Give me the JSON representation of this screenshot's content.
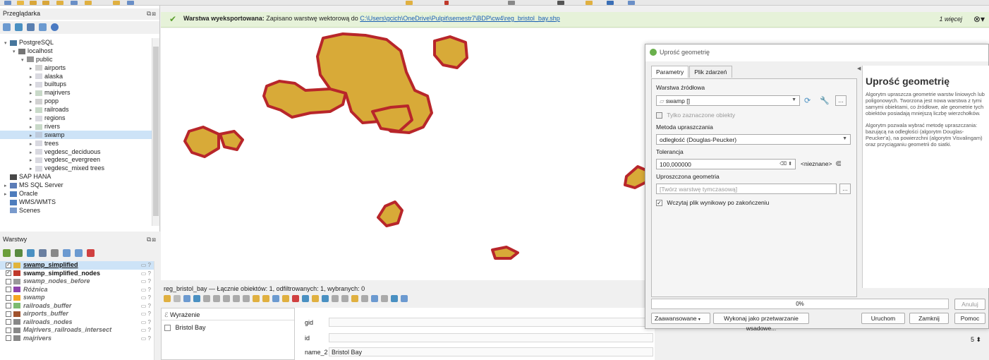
{
  "browser_panel": {
    "title": "Przeglądarka",
    "tree": [
      {
        "label": "PostgreSQL",
        "level": 0,
        "arrow": "▾",
        "icon": "postgres-icon"
      },
      {
        "label": "localhost",
        "level": 1,
        "arrow": "▾",
        "icon": "server-icon"
      },
      {
        "label": "public",
        "level": 2,
        "arrow": "▾",
        "icon": "schema-icon"
      },
      {
        "label": "airports",
        "level": 3,
        "arrow": "▸",
        "icon": "point-layer-icon"
      },
      {
        "label": "alaska",
        "level": 3,
        "arrow": "▸",
        "icon": "polygon-layer-icon"
      },
      {
        "label": "builtups",
        "level": 3,
        "arrow": "▸",
        "icon": "polygon-layer-icon"
      },
      {
        "label": "majrivers",
        "level": 3,
        "arrow": "▸",
        "icon": "line-layer-icon"
      },
      {
        "label": "popp",
        "level": 3,
        "arrow": "▸",
        "icon": "point-layer-icon"
      },
      {
        "label": "railroads",
        "level": 3,
        "arrow": "▸",
        "icon": "line-layer-icon"
      },
      {
        "label": "regions",
        "level": 3,
        "arrow": "▸",
        "icon": "polygon-layer-icon"
      },
      {
        "label": "rivers",
        "level": 3,
        "arrow": "▸",
        "icon": "line-layer-icon"
      },
      {
        "label": "swamp",
        "level": 3,
        "arrow": "▸",
        "icon": "polygon-layer-icon",
        "selected": true
      },
      {
        "label": "trees",
        "level": 3,
        "arrow": "▸",
        "icon": "polygon-layer-icon"
      },
      {
        "label": "vegdesc_deciduous",
        "level": 3,
        "arrow": "▸",
        "icon": "polygon-layer-icon"
      },
      {
        "label": "vegdesc_evergreen",
        "level": 3,
        "arrow": "▸",
        "icon": "polygon-layer-icon"
      },
      {
        "label": "vegdesc_mixed trees",
        "level": 3,
        "arrow": "▸",
        "icon": "polygon-layer-icon"
      },
      {
        "label": "SAP HANA",
        "level": 0,
        "arrow": "",
        "icon": "sap-icon"
      },
      {
        "label": "MS SQL Server",
        "level": 0,
        "arrow": "▸",
        "icon": "mssql-icon"
      },
      {
        "label": "Oracle",
        "level": 0,
        "arrow": "▸",
        "icon": "oracle-icon"
      },
      {
        "label": "WMS/WMTS",
        "level": 0,
        "arrow": "",
        "icon": "wms-icon"
      },
      {
        "label": "Scenes",
        "level": 0,
        "arrow": "",
        "icon": "scenes-icon"
      }
    ]
  },
  "layers_panel": {
    "title": "Warstwy",
    "layers": [
      {
        "label": "swamp_simplified",
        "checked": true,
        "swatch": "#e1b43c",
        "style": "bold",
        "selected": true
      },
      {
        "label": "swamp_simplified_nodes",
        "checked": true,
        "swatch": "#c0392b",
        "style": "act"
      },
      {
        "label": "swamp_nodes_before",
        "checked": false,
        "swatch": "#999999",
        "style": "off"
      },
      {
        "label": "Różnica",
        "checked": false,
        "swatch": "#8e44ad",
        "style": "off"
      },
      {
        "label": "swamp",
        "checked": false,
        "swatch": "#f5a623",
        "style": "off"
      },
      {
        "label": "railroads_buffer",
        "checked": false,
        "swatch": "#7dbb6f",
        "style": "off"
      },
      {
        "label": "airports_buffer",
        "checked": false,
        "swatch": "#a0522d",
        "style": "off"
      },
      {
        "label": "railroads_nodes",
        "checked": false,
        "swatch": "#888888",
        "style": "off"
      },
      {
        "label": "Majrivers_railroads_intersect",
        "checked": false,
        "swatch": "#888888",
        "style": "off"
      },
      {
        "label": "majrivers",
        "checked": false,
        "swatch": "#888888",
        "style": "off"
      }
    ]
  },
  "message_bar": {
    "bold": "Warstwa wyeksportowana:",
    "text": " Zapisano warstwę wektorową do ",
    "link": "C:\\Users\\gcich\\OneDrive\\Pulpit\\semestr7\\BDP\\cw4\\reg_bristol_bay.shp",
    "more": "1 więcej"
  },
  "attribute_table": {
    "title": "reg_bristol_bay — Łącznie obiektów: 1, odfiltrowanych: 1, wybranych: 0",
    "expression_label": "Wyrażenie",
    "row_label": "Bristol Bay",
    "fields": [
      {
        "name": "gid",
        "value": ""
      },
      {
        "name": "id",
        "value": ""
      },
      {
        "name": "name_2",
        "value": "Bristol Bay"
      }
    ],
    "spin_value": "5"
  },
  "dialog": {
    "title": "Uprość geometrię",
    "tabs": [
      "Parametry",
      "Plik zdarzeń"
    ],
    "source_label": "Warstwa źródłowa",
    "source_value": "swamp []",
    "only_selected": "Tylko zaznaczone obiekty",
    "method_label": "Metoda upraszczania",
    "method_value": "odległość (Douglas-Peucker)",
    "tolerance_label": "Tolerancja",
    "tolerance_value": "100,000000",
    "tolerance_unit": "<nieznane>",
    "output_label": "Uproszczona geometria",
    "output_placeholder": "[Twórz warstwę tymczasową]",
    "load_result": "Wczytaj plik wynikowy po zakończeniu",
    "help_title": "Uprość geometrię",
    "help_p1": "Algorytm upraszcza geometrie warstw liniowych lub poligonowych. Tworzona jest nowa warstwa z tymi samymi obiektami, co źródłowe, ale geometrie tych obiektów posiadają mniejszą liczbę wierzchołków.",
    "help_p2": "Algorytm pozwala wybrać metodę upraszczania: bazującą na odległości (algorytm Douglas-Peucker'a), na powierzchni (algorytm Visvalingam) oraz przyciąganiu geometrii do siatki.",
    "progress": "0%",
    "cancel": "Anuluj",
    "advanced": "Zaawansowane",
    "batch": "Wykonaj jako przetwarzanie wsadowe...",
    "run": "Uruchom",
    "close": "Zamknij",
    "help": "Pomoc"
  },
  "colors": {
    "polygon_fill": "#d8aa38",
    "polygon_outline": "#b8262a",
    "success_bar": "#e6f2d9"
  }
}
